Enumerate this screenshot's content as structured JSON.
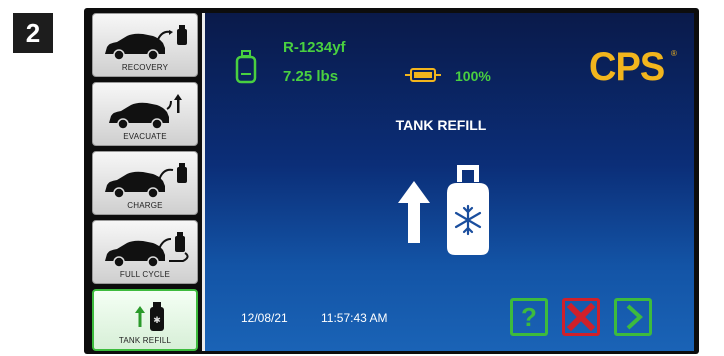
{
  "step_number": "2",
  "sidebar": {
    "items": [
      {
        "label": "RECOVERY"
      },
      {
        "label": "EVACUATE"
      },
      {
        "label": "CHARGE"
      },
      {
        "label": "FULL CYCLE"
      },
      {
        "label": "TANK REFILL"
      }
    ],
    "active_index": 4
  },
  "status": {
    "refrigerant": "R-1234yf",
    "weight": "7.25 lbs",
    "battery_percent": "100%"
  },
  "brand": {
    "logo_text": "CPS",
    "registered_mark": "®",
    "color": "#f2b51d"
  },
  "screen": {
    "title": "TANK REFILL"
  },
  "footer": {
    "date": "12/08/21",
    "time": "11:57:43 AM"
  },
  "buttons": {
    "help_label": "?"
  },
  "colors": {
    "accent_green": "#3dbb3d",
    "cancel_red": "#d0202a",
    "logo_gold": "#f2b51d"
  }
}
